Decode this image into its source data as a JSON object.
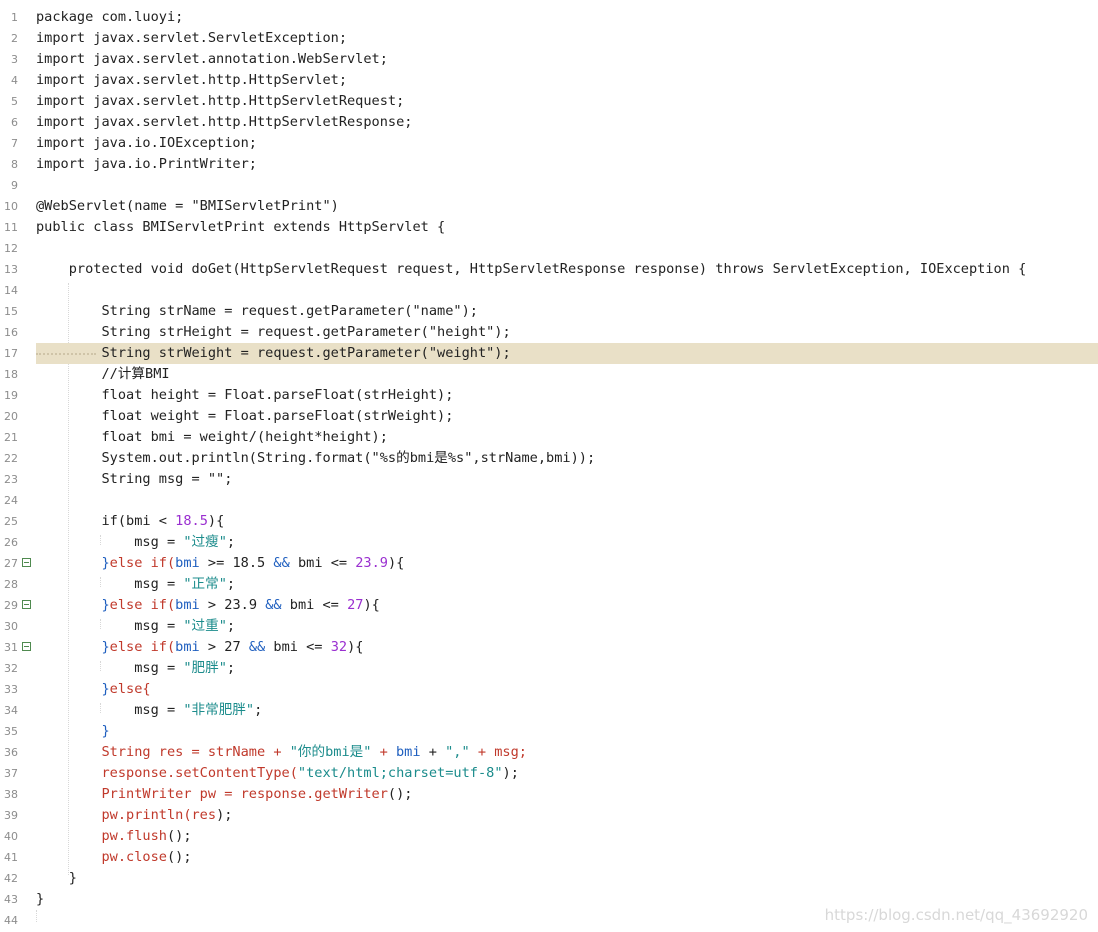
{
  "editor": {
    "lines": [
      {
        "n": "1",
        "text": "package com.luoyi;"
      },
      {
        "n": "2",
        "text": "import javax.servlet.ServletException;"
      },
      {
        "n": "3",
        "text": "import javax.servlet.annotation.WebServlet;"
      },
      {
        "n": "4",
        "text": "import javax.servlet.http.HttpServlet;"
      },
      {
        "n": "5",
        "text": "import javax.servlet.http.HttpServletRequest;"
      },
      {
        "n": "6",
        "text": "import javax.servlet.http.HttpServletResponse;"
      },
      {
        "n": "7",
        "text": "import java.io.IOException;"
      },
      {
        "n": "8",
        "text": "import java.io.PrintWriter;"
      },
      {
        "n": "9",
        "text": ""
      },
      {
        "n": "10",
        "text": "@WebServlet(name = \"BMIServletPrint\")"
      },
      {
        "n": "11",
        "text": "public class BMIServletPrint extends HttpServlet {"
      },
      {
        "n": "12",
        "text": ""
      },
      {
        "n": "13",
        "text": "    protected void doGet(HttpServletRequest request, HttpServletResponse response) throws ServletException, IOException {"
      },
      {
        "n": "14",
        "text": ""
      },
      {
        "n": "15",
        "text": "        String strName = request.getParameter(\"name\");"
      },
      {
        "n": "16",
        "text": "        String strHeight = request.getParameter(\"height\");"
      },
      {
        "n": "17",
        "text": "        String strWeight = request.getParameter(\"weight\");",
        "current": true
      },
      {
        "n": "18",
        "text": "        //计算BMI"
      },
      {
        "n": "19",
        "text": "        float height = Float.parseFloat(strHeight);"
      },
      {
        "n": "20",
        "text": "        float weight = Float.parseFloat(strWeight);"
      },
      {
        "n": "21",
        "text": "        float bmi = weight/(height*height);"
      },
      {
        "n": "22",
        "text": "        System.out.println(String.format(\"%s的bmi是%s\",strName,bmi));"
      },
      {
        "n": "23",
        "text": "        String msg = \"\";"
      },
      {
        "n": "24",
        "text": ""
      },
      {
        "n": "25",
        "tokens": [
          [
            "        if(bmi < ",
            ""
          ],
          [
            "18.5",
            "num"
          ],
          [
            "){",
            ""
          ]
        ]
      },
      {
        "n": "26",
        "tokens": [
          [
            "            msg = ",
            ""
          ],
          [
            "\"过瘦\"",
            "str"
          ],
          [
            ";",
            ""
          ]
        ]
      },
      {
        "n": "27",
        "fold": true,
        "tokens": [
          [
            "        }",
            "blue"
          ],
          [
            "else if(",
            "red"
          ],
          [
            "bmi ",
            "blue"
          ],
          [
            ">= 18.5 ",
            ""
          ],
          [
            "&& ",
            "blue"
          ],
          [
            "bmi <= ",
            ""
          ],
          [
            "23.9",
            "num"
          ],
          [
            "){",
            ""
          ]
        ]
      },
      {
        "n": "28",
        "tokens": [
          [
            "            msg = ",
            ""
          ],
          [
            "\"正常\"",
            "str"
          ],
          [
            ";",
            ""
          ]
        ]
      },
      {
        "n": "29",
        "fold": true,
        "tokens": [
          [
            "        }",
            "blue"
          ],
          [
            "else if(",
            "red"
          ],
          [
            "bmi ",
            "blue"
          ],
          [
            "> 23.9 ",
            ""
          ],
          [
            "&& ",
            "blue"
          ],
          [
            "bmi <= ",
            ""
          ],
          [
            "27",
            "num"
          ],
          [
            "){",
            ""
          ]
        ]
      },
      {
        "n": "30",
        "tokens": [
          [
            "            msg = ",
            ""
          ],
          [
            "\"过重\"",
            "str"
          ],
          [
            ";",
            ""
          ]
        ]
      },
      {
        "n": "31",
        "fold": true,
        "tokens": [
          [
            "        }",
            "blue"
          ],
          [
            "else if(",
            "red"
          ],
          [
            "bmi ",
            "blue"
          ],
          [
            "> 27 ",
            ""
          ],
          [
            "&& ",
            "blue"
          ],
          [
            "bmi <= ",
            ""
          ],
          [
            "32",
            "num"
          ],
          [
            "){",
            ""
          ]
        ]
      },
      {
        "n": "32",
        "tokens": [
          [
            "            msg = ",
            ""
          ],
          [
            "\"肥胖\"",
            "str"
          ],
          [
            ";",
            ""
          ]
        ]
      },
      {
        "n": "33",
        "tokens": [
          [
            "        }",
            "blue"
          ],
          [
            "else{",
            "red"
          ]
        ]
      },
      {
        "n": "34",
        "tokens": [
          [
            "            msg = ",
            ""
          ],
          [
            "\"非常肥胖\"",
            "str"
          ],
          [
            ";",
            ""
          ]
        ]
      },
      {
        "n": "35",
        "tokens": [
          [
            "        }",
            "blue"
          ]
        ]
      },
      {
        "n": "36",
        "tokens": [
          [
            "        String res = strName + ",
            "red"
          ],
          [
            "\"你的bmi是\"",
            "str"
          ],
          [
            " + ",
            "red"
          ],
          [
            "bmi ",
            "blue"
          ],
          [
            "+ ",
            ""
          ],
          [
            "\",\"",
            "str"
          ],
          [
            " + msg;",
            "red"
          ]
        ]
      },
      {
        "n": "37",
        "tokens": [
          [
            "        response.setContentType(",
            "red"
          ],
          [
            "\"text/html;charset=utf-8\"",
            "str"
          ],
          [
            ");",
            ""
          ]
        ]
      },
      {
        "n": "38",
        "tokens": [
          [
            "        PrintWriter pw = response.getWriter",
            "red"
          ],
          [
            "();",
            ""
          ]
        ]
      },
      {
        "n": "39",
        "tokens": [
          [
            "        pw.println(",
            "red"
          ],
          [
            "res",
            "red"
          ],
          [
            ");",
            ""
          ]
        ]
      },
      {
        "n": "40",
        "tokens": [
          [
            "        pw.flush",
            "red"
          ],
          [
            "();",
            ""
          ]
        ]
      },
      {
        "n": "41",
        "tokens": [
          [
            "        pw.close",
            "red"
          ],
          [
            "();",
            ""
          ]
        ]
      },
      {
        "n": "42",
        "text": "    }"
      },
      {
        "n": "43",
        "text": "}"
      },
      {
        "n": "44",
        "text": ""
      }
    ]
  },
  "watermark": "https://blog.csdn.net/qq_43692920",
  "colors": {
    "current_line": "#e9e0c7",
    "string": "#1c8c8c",
    "number": "#9a2fd0",
    "keyword_red": "#c0392b",
    "operator_blue": "#1f5fbf"
  }
}
